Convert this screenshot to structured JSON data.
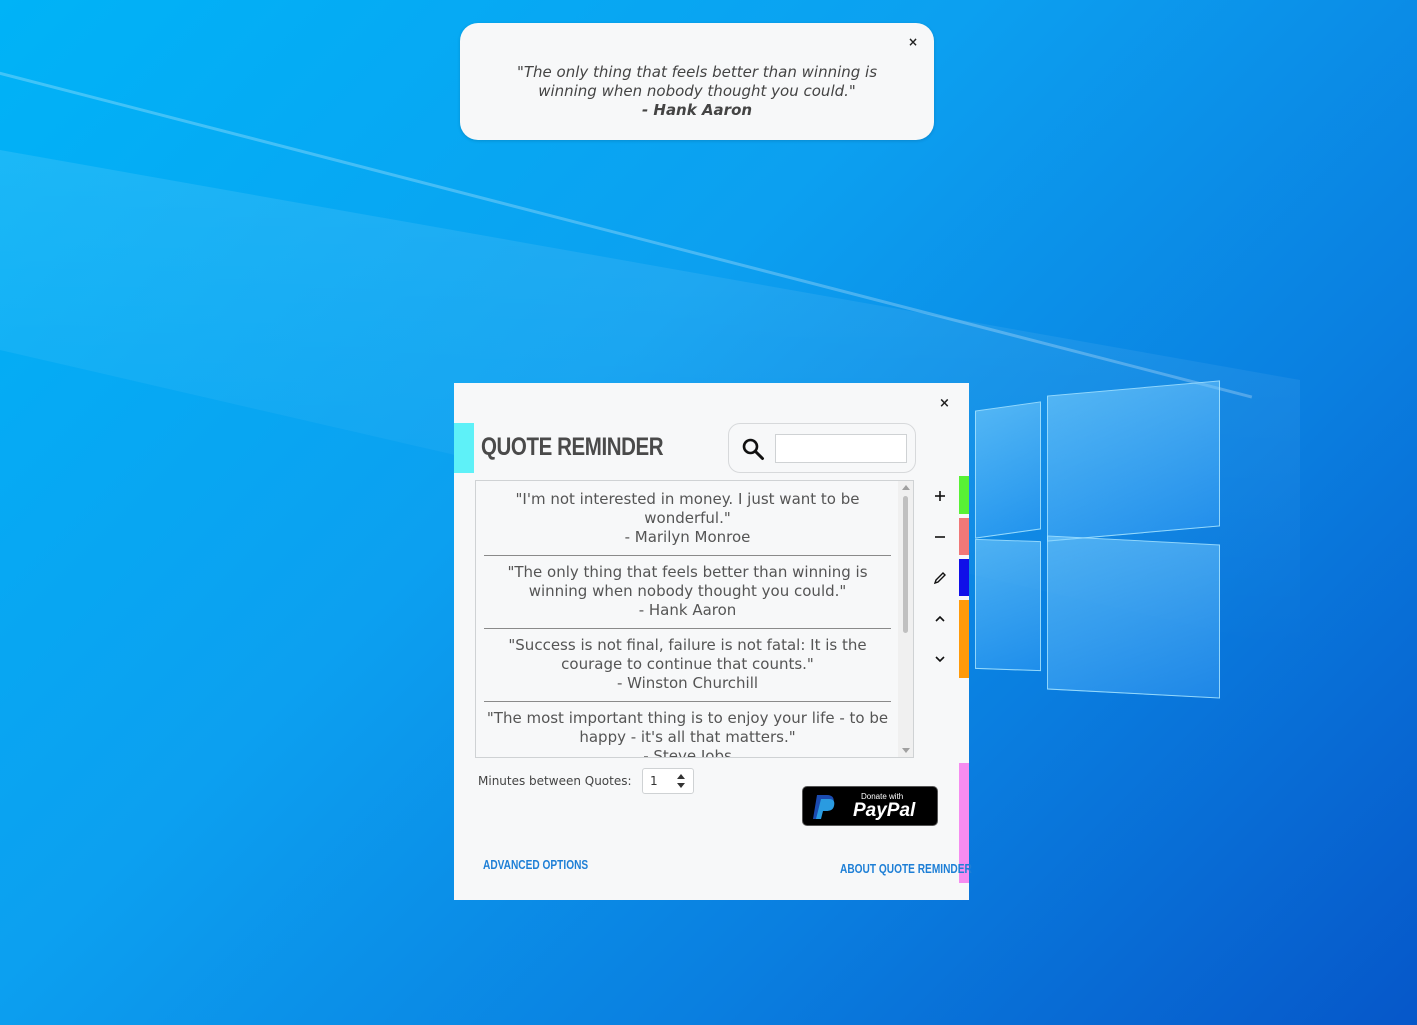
{
  "toast": {
    "quote": "\"The only thing that feels better than winning is winning when nobody thought you could.\"",
    "author": "- Hank Aaron",
    "close_label": "×"
  },
  "app": {
    "title": "Quote Reminder",
    "close_label": "×",
    "search": {
      "value": "",
      "placeholder": ""
    },
    "quotes": [
      {
        "text": "\"I'm not interested in money. I just want to be wonderful.\"",
        "author": "- Marilyn Monroe"
      },
      {
        "text": "\"The only thing that feels better than winning is winning when nobody thought you could.\"",
        "author": "- Hank Aaron"
      },
      {
        "text": "\"Success is not final, failure is not fatal: It is the courage to continue that counts.\"",
        "author": "- Winston Churchill"
      },
      {
        "text": "\"The most important thing is to enjoy your life - to be happy - it's all that matters.\"",
        "author": "- Steve Jobs"
      }
    ],
    "side_buttons": [
      {
        "name": "add",
        "icon": "plus-icon",
        "color": "#58f135"
      },
      {
        "name": "remove",
        "icon": "minus-icon",
        "color": "#f07878"
      },
      {
        "name": "edit",
        "icon": "pencil-icon",
        "color": "#1010e8"
      },
      {
        "name": "move-up",
        "icon": "chevron-up-icon",
        "color": "#ff9a0a"
      },
      {
        "name": "move-down",
        "icon": "chevron-down-icon",
        "color": "#ff9a0a"
      }
    ],
    "accent_color": "#5ef1f8",
    "pink_tab_color": "#f68cf0",
    "minutes": {
      "label": "Minutes between Quotes:",
      "value": "1"
    },
    "paypal": {
      "small": "Donate with",
      "big": "PayPal"
    },
    "advanced_link": "Advanced Options",
    "about_link": "About Quote Reminder"
  }
}
